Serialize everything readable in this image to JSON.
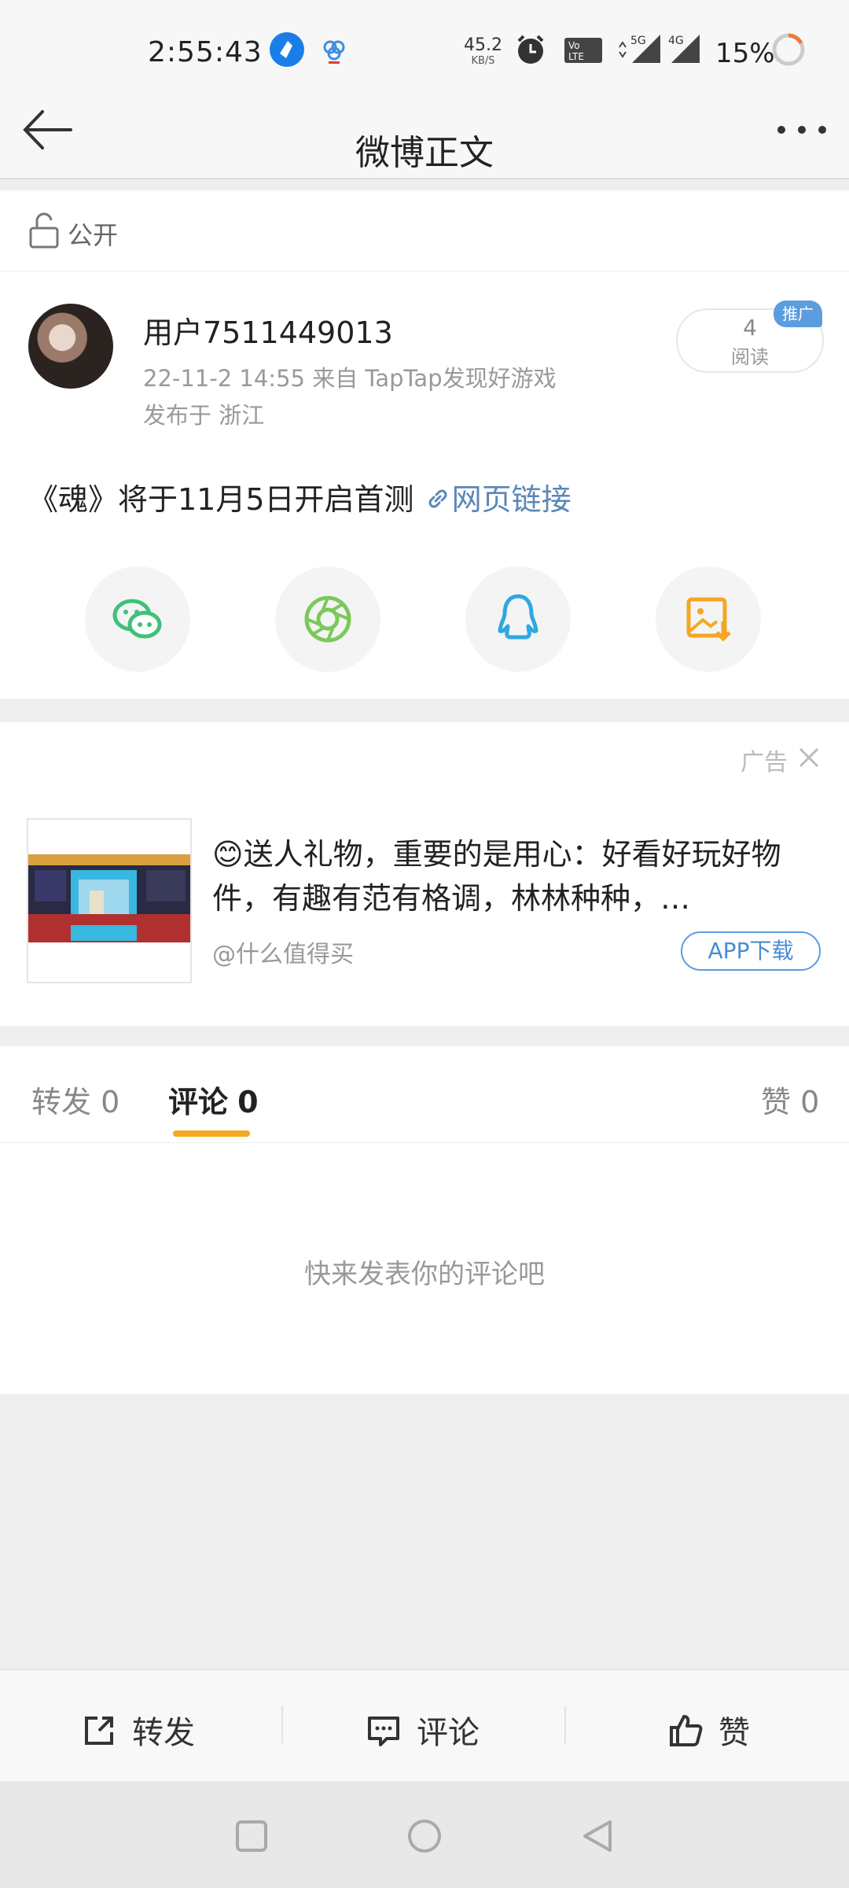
{
  "status_bar": {
    "time": "2:55:43",
    "net_speed": "45.2",
    "net_unit": "KB/S",
    "sig1": "5G",
    "sig2": "4G",
    "volte": "Vo LTE",
    "battery": "15%"
  },
  "header": {
    "title": "微博正文"
  },
  "post": {
    "visibility": "公开",
    "username": "用户7511449013",
    "meta_line": "22-11-2 14:55   来自 TapTap发现好游戏",
    "location": "发布于 浙江",
    "read_count": "4",
    "read_label": "阅读",
    "promote_badge": "推广",
    "content": "《魂》将于11月5日开启首测 ",
    "link_text": "网页链接"
  },
  "share": {
    "icons": [
      "wechat-icon",
      "moments-icon",
      "qq-icon",
      "save-image-icon"
    ],
    "colors": [
      "#3fc17a",
      "#7cc85a",
      "#2fa8e0",
      "#f5a623"
    ]
  },
  "ad": {
    "label": "广告",
    "title": "😊送人礼物，重要的是用心：好看好玩好物件，有趣有范有格调，林林种种，…",
    "source": "@什么值得买",
    "button": "APP下载"
  },
  "tabs": {
    "repost": "转发",
    "repost_count": "0",
    "comment": "评论",
    "comment_count": "0",
    "like": "赞",
    "like_count": "0",
    "active": "comment"
  },
  "comments": {
    "empty_text": "快来发表你的评论吧"
  },
  "actions": {
    "repost": "转发",
    "comment": "评论",
    "like": "赞"
  },
  "colors": {
    "accent": "#f5a623",
    "link": "#5b86b8",
    "promo": "#5b9dde"
  }
}
